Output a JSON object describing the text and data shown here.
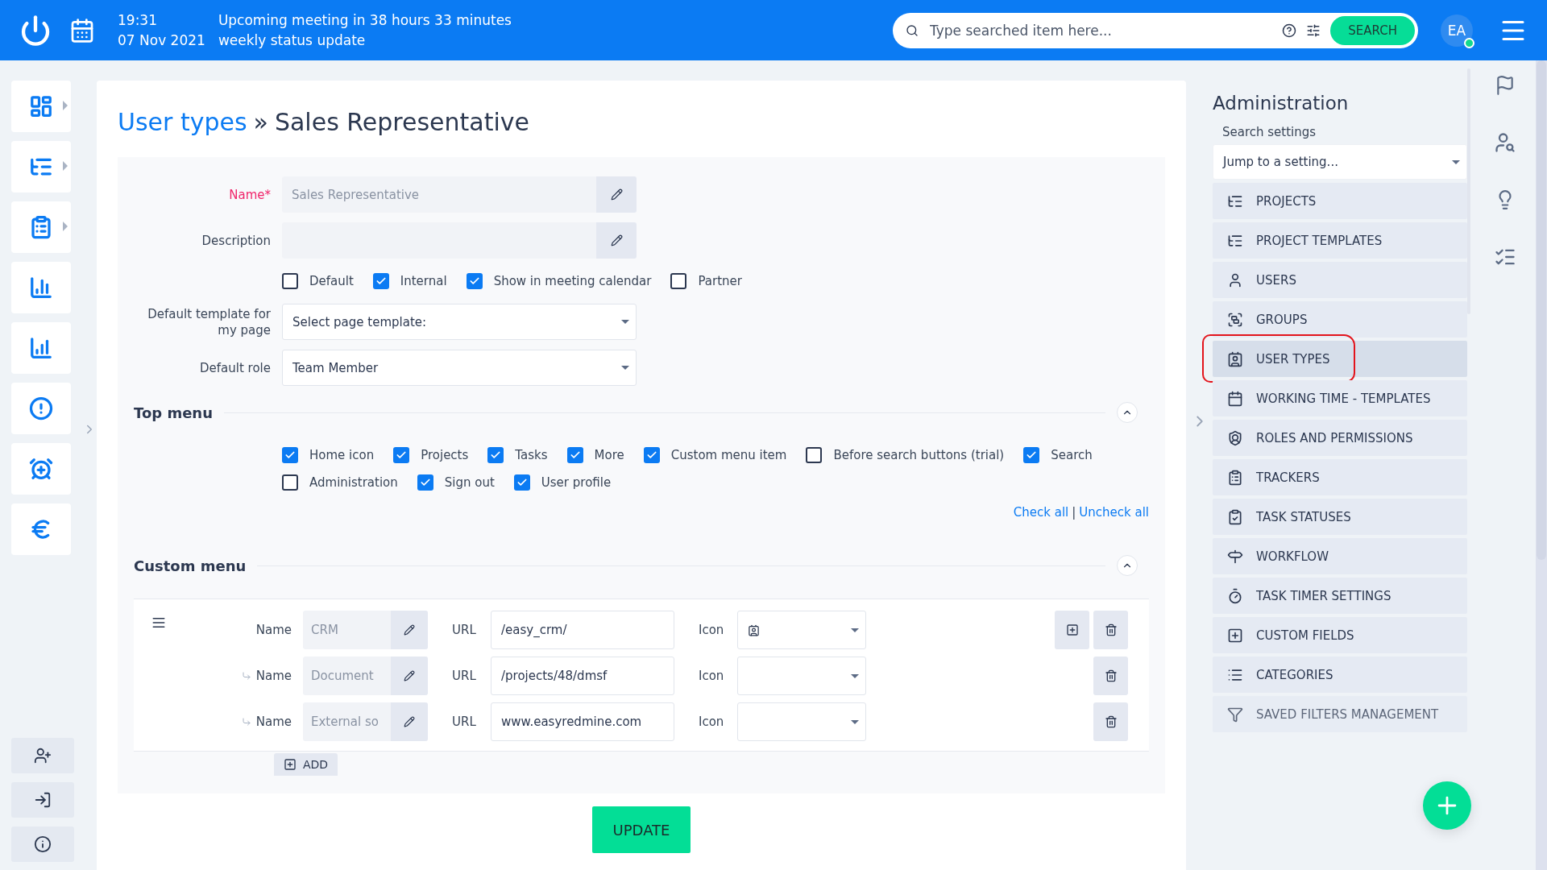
{
  "topbar": {
    "time": "19:31",
    "meeting": "Upcoming meeting in 38 hours 33 minutes",
    "date": "07 Nov 2021",
    "meeting_title": "weekly status update",
    "search": {
      "placeholder": "Type searched item here..."
    },
    "search_button": "SEARCH",
    "avatar": "EA",
    "online": true
  },
  "sidebar": {
    "items": [
      {
        "expandable": true
      },
      {
        "expandable": true
      },
      {
        "expandable": true
      },
      {
        "expandable": false
      },
      {
        "expandable": false
      },
      {
        "expandable": false
      },
      {
        "expandable": false
      },
      {
        "expandable": false
      }
    ]
  },
  "page": {
    "breadcrumb": "User types",
    "separator": "»",
    "title": "Sales Representative"
  },
  "form": {
    "fields": [
      {
        "label": "Name*",
        "required": true,
        "value": "Sales Representative"
      },
      {
        "label": "Description",
        "required": false
      }
    ],
    "flags": [
      {
        "label": "Default",
        "checked": false
      },
      {
        "label": "Internal",
        "checked": true
      },
      {
        "label": "Show in meeting calendar",
        "checked": true
      },
      {
        "label": "Partner",
        "checked": false
      }
    ],
    "selects": [
      {
        "label": "Default template for my page",
        "value": "Select page template:"
      },
      {
        "label": "Default role",
        "value": "Team Member"
      }
    ]
  },
  "top_menu": {
    "title": "Top menu",
    "expanded": true,
    "options": [
      {
        "label": "Home icon",
        "checked": true
      },
      {
        "label": "Projects",
        "checked": true
      },
      {
        "label": "Tasks",
        "checked": true
      },
      {
        "label": "More",
        "checked": true
      },
      {
        "label": "Custom menu item",
        "checked": true
      },
      {
        "label": "Before search buttons (trial)",
        "checked": false
      },
      {
        "label": "Search",
        "checked": true
      },
      {
        "label": "Administration",
        "checked": false
      },
      {
        "label": "Sign out",
        "checked": true
      },
      {
        "label": "User profile",
        "checked": true
      }
    ],
    "check_all": "Check all",
    "separator": "|",
    "uncheck_all": "Uncheck all"
  },
  "custom_menu": {
    "title": "Custom menu",
    "expanded": true,
    "rows": [
      {
        "child": false,
        "name_label": "Name",
        "name": "CRM",
        "url_label": "URL",
        "url": "/easy_crm/",
        "icon_label": "Icon",
        "has_icon": true,
        "can_add": true
      },
      {
        "child": true,
        "name_label": "Name",
        "name": "Document",
        "url_label": "URL",
        "url": "/projects/48/dmsf",
        "icon_label": "Icon",
        "has_icon": false,
        "can_add": false
      },
      {
        "child": true,
        "name_label": "Name",
        "name": "External so",
        "url_label": "URL",
        "url": "www.easyredmine.com",
        "icon_label": "Icon",
        "has_icon": false,
        "can_add": false
      }
    ],
    "add_button": "ADD"
  },
  "update_button": "UPDATE",
  "admin": {
    "title": "Administration",
    "search_label": "Search settings",
    "jump_placeholder": "Jump to a setting...",
    "items": [
      {
        "label": "PROJECTS",
        "selected": false,
        "circled": false
      },
      {
        "label": "PROJECT TEMPLATES",
        "selected": false,
        "circled": false
      },
      {
        "label": "USERS",
        "selected": false,
        "circled": false
      },
      {
        "label": "GROUPS",
        "selected": false,
        "circled": false
      },
      {
        "label": "USER TYPES",
        "selected": true,
        "circled": true
      },
      {
        "label": "WORKING TIME - TEMPLATES",
        "selected": false,
        "circled": false
      },
      {
        "label": "ROLES AND PERMISSIONS",
        "selected": false,
        "circled": false
      },
      {
        "label": "TRACKERS",
        "selected": false,
        "circled": false
      },
      {
        "label": "TASK STATUSES",
        "selected": false,
        "circled": false
      },
      {
        "label": "WORKFLOW",
        "selected": false,
        "circled": false
      },
      {
        "label": "TASK TIMER SETTINGS",
        "selected": false,
        "circled": false
      },
      {
        "label": "CUSTOM FIELDS",
        "selected": false,
        "circled": false
      },
      {
        "label": "CATEGORIES",
        "selected": false,
        "circled": false
      },
      {
        "label": "SAVED FILTERS MANAGEMENT",
        "selected": false,
        "circled": false
      }
    ]
  }
}
